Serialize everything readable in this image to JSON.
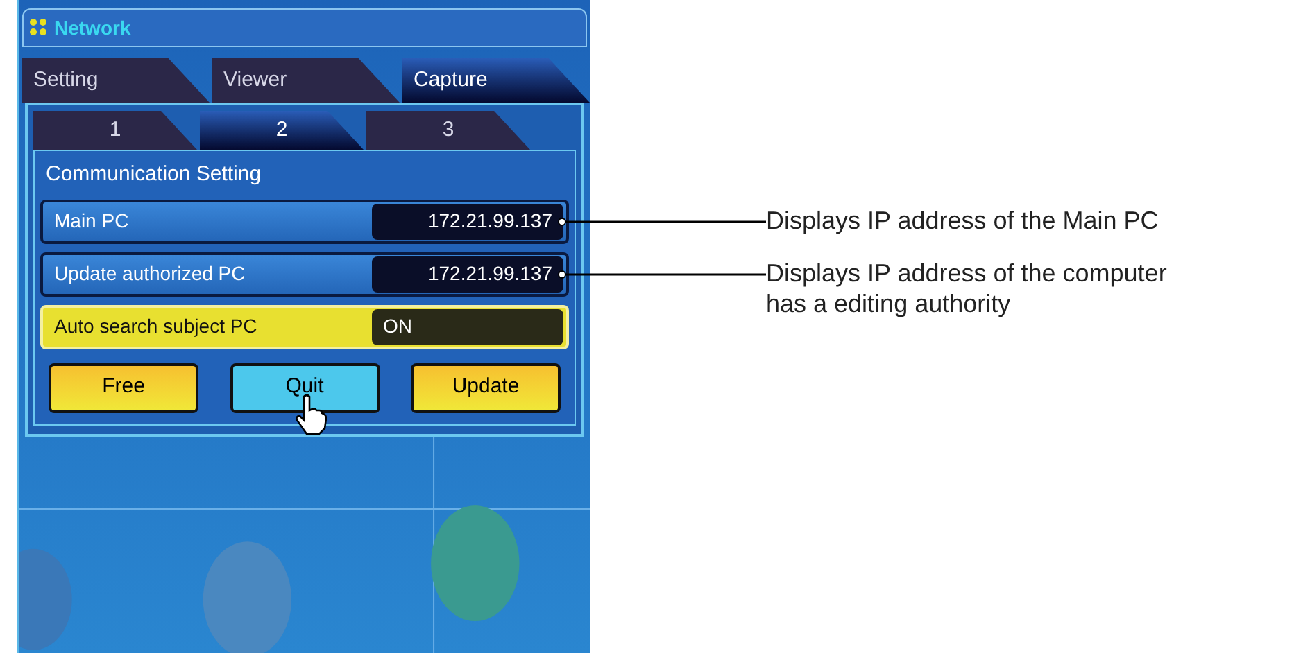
{
  "window": {
    "title": "Network"
  },
  "tabs": [
    {
      "label": "Setting",
      "selected": false
    },
    {
      "label": "Viewer",
      "selected": false
    },
    {
      "label": "Capture",
      "selected": true
    }
  ],
  "subtabs": [
    {
      "label": "1",
      "selected": false
    },
    {
      "label": "2",
      "selected": true
    },
    {
      "label": "3",
      "selected": false
    }
  ],
  "section": {
    "title": "Communication Setting"
  },
  "rows": [
    {
      "kind": "display",
      "label": "Main PC",
      "value": "172.21.99.137",
      "callout": [
        "Displays IP address of the Main PC"
      ]
    },
    {
      "kind": "display",
      "label": "Update authorized PC",
      "value": "172.21.99.137",
      "callout": [
        "Displays IP address of the computer",
        "has a editing authority"
      ]
    },
    {
      "kind": "highlight",
      "label": "Auto search subject PC",
      "value": "ON"
    }
  ],
  "buttons": [
    {
      "label": "Free",
      "hovered": false
    },
    {
      "label": "Quit",
      "hovered": true
    },
    {
      "label": "Update",
      "hovered": false
    }
  ]
}
